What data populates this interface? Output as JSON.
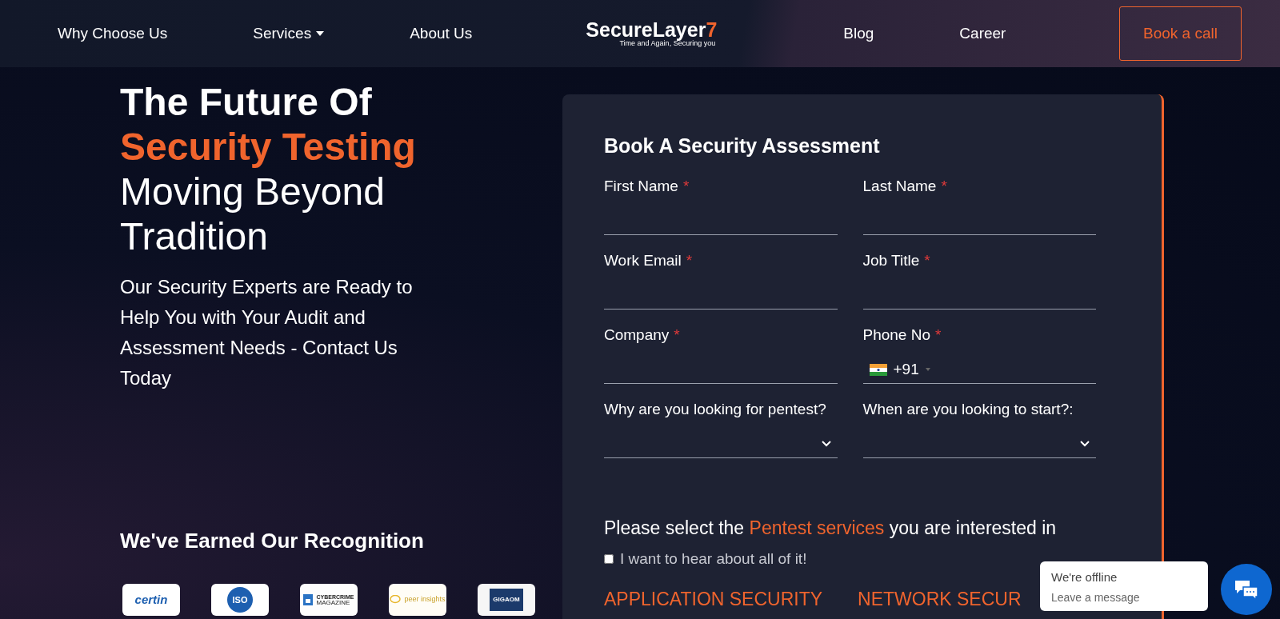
{
  "nav": {
    "left": [
      {
        "label": "Why Choose Us",
        "dropdown": false
      },
      {
        "label": "Services",
        "dropdown": true
      },
      {
        "label": "About Us",
        "dropdown": false
      }
    ],
    "logo": {
      "name": "SecureLayer",
      "mark": "7",
      "tagline": "Time and Again, Securing you"
    },
    "right": [
      {
        "label": "Blog",
        "dropdown": false
      },
      {
        "label": "Career",
        "dropdown": false
      }
    ],
    "cta": "Book a call"
  },
  "hero": {
    "heading": [
      "The Future Of",
      "Security Testing",
      "Moving Beyond Tradition"
    ],
    "subtext": "Our Security Experts are Ready to Help You with Your Audit and Assessment Needs - Contact Us Today",
    "recognition_title": "We've Earned Our Recognition",
    "badges": [
      {
        "kind": "certin",
        "texts": [
          "certin"
        ]
      },
      {
        "kind": "iso",
        "texts": [
          "ISO"
        ]
      },
      {
        "kind": "magazine",
        "texts": [
          "CYBERCRIME",
          "MAGAZINE"
        ]
      },
      {
        "kind": "peer",
        "texts": [
          "peer insights"
        ]
      },
      {
        "kind": "gigaom",
        "texts": [
          "GIGAOM"
        ]
      }
    ]
  },
  "form": {
    "title": "Book A Security Assessment",
    "fields": [
      {
        "label": "First Name",
        "required_mark": "*",
        "kind": "text"
      },
      {
        "label": "Last Name",
        "required_mark": "*",
        "kind": "text"
      },
      {
        "label": "Work Email",
        "required_mark": "*",
        "kind": "text"
      },
      {
        "label": "Job Title",
        "required_mark": "*",
        "kind": "text"
      },
      {
        "label": "Company",
        "required_mark": "*",
        "kind": "text"
      },
      {
        "label": "Phone No",
        "required_mark": "*",
        "kind": "phone",
        "prefix": "+91"
      },
      {
        "label": "Why are you looking for pentest?",
        "kind": "select"
      },
      {
        "label": "When are you looking to start?:",
        "kind": "select"
      }
    ],
    "services_prompt": "Please select the **Pentest services** you are interested in",
    "all_option": {
      "label": "I want to hear about all of it!",
      "checked": false
    },
    "categories": [
      "APPLICATION SECURITY",
      "NETWORK SECUR"
    ]
  },
  "chat": {
    "title": "We're offline",
    "subtitle": "Leave a message"
  }
}
